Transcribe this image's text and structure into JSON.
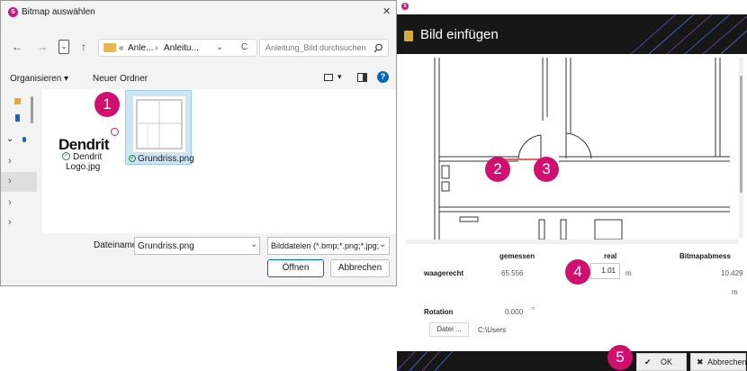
{
  "file_dialog": {
    "title": "Bitmap auswählen",
    "close_glyph": "✕",
    "app_icon_letter": "S",
    "nav": {
      "back": "←",
      "forward": "→",
      "up": "↑",
      "dropdown": "⌄",
      "refresh": "C",
      "chevron": "⌄"
    },
    "address": {
      "prefix": "«",
      "seg1": "Anle...",
      "sep": "›",
      "seg2": "Anleitu..."
    },
    "search_placeholder": "Anleitung_Bild durchsuchen",
    "toolbar": {
      "organize": "Organisieren ▾",
      "new_folder": "Neuer Ordner",
      "view_chevron": "▾",
      "help": "?"
    },
    "nav_tree": {
      "expand": "⌄",
      "chevrons": [
        "›",
        "›",
        "›",
        "›"
      ]
    },
    "files": [
      {
        "name_line1": "Dendrit",
        "name_line2": "Logo.jpg",
        "logo_text": "Dendrit",
        "status": "synced"
      },
      {
        "name_line1": "Grundriss.png",
        "status": "synced",
        "selected": true
      }
    ],
    "bottom": {
      "filename_label": "Dateiname:",
      "filename_value": "Grundriss.png",
      "filter_value": "Bilddateien (*.bmp;*.png;*.jpg;",
      "open_button": "Öffnen",
      "cancel_button": "Abbrechen"
    }
  },
  "insert_dialog": {
    "title": "Bild einfügen",
    "headers": {
      "measured": "gemessen",
      "real": "real",
      "bitmap": "Bitmapabmess"
    },
    "row_label": "waagerecht",
    "measured_value": "65.556",
    "real_value": "1.01",
    "real_unit": "m",
    "bitmap_value": "10.429",
    "bitmap_unit": "m",
    "rotation_label": "Rotation",
    "rotation_value": "0.000",
    "rotation_unit": "°",
    "file_button": "Datei ...",
    "file_path": "C:\\Users",
    "ok_button": "OK",
    "cancel_button": "Abbrechen",
    "ok_icon": "✔",
    "cancel_icon": "✖"
  },
  "badges": [
    "1",
    "2",
    "3",
    "4",
    "5"
  ],
  "colors": {
    "badge": "#d10f6e",
    "brand": "#c01c79",
    "accent": "#0067c0",
    "measure_line": "#e03030"
  }
}
